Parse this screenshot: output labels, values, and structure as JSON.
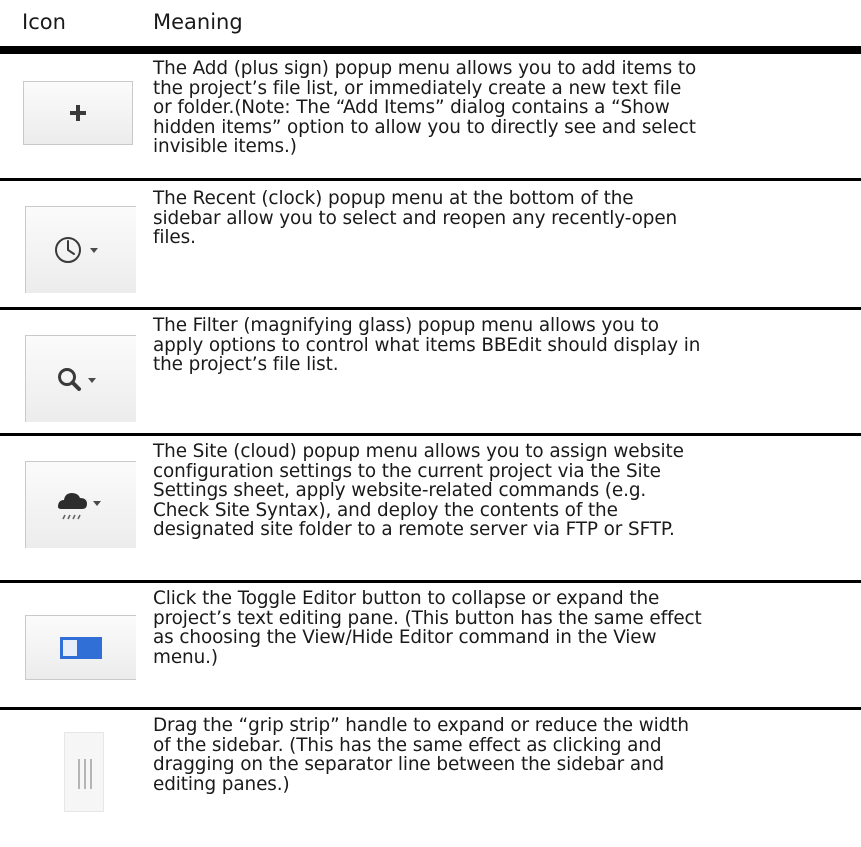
{
  "header": {
    "icon_col": "Icon",
    "meaning_col": "Meaning"
  },
  "rows": [
    {
      "icon": "plus-icon",
      "text": "The Add (plus sign) popup menu allows you to add items to\nthe project’s file list, or immediately create a new text file\nor folder.(Note: The “Add Items” dialog contains a “Show\nhidden items” option to allow you to directly see and select\ninvisible items.)"
    },
    {
      "icon": "clock-icon",
      "text": "The Recent (clock) popup menu at the bottom of the\nsidebar allow you to select and reopen any recently-open\nfiles."
    },
    {
      "icon": "magnifying-glass-icon",
      "text": "The Filter (magnifying glass) popup menu allows you to\napply options to control what items BBEdit should display in\nthe project’s file list."
    },
    {
      "icon": "cloud-icon",
      "text": "The Site (cloud) popup menu allows you to assign website\nconfiguration settings to the current project via the Site\nSettings sheet, apply website-related commands (e.g.\nCheck Site Syntax), and deploy the contents of the\ndesignated site folder to a remote server via FTP or SFTP."
    },
    {
      "icon": "toggle-editor-icon",
      "text": "Click the Toggle Editor button to collapse or expand the\nproject’s text editing pane. (This button has the same effect\nas choosing the View/Hide Editor command in the View\nmenu.)"
    },
    {
      "icon": "grip-strip-icon",
      "text": "Drag the “grip strip” handle to expand or reduce the width\nof the sidebar. (This has the same effect as clicking and\ndragging on the separator line between the sidebar and\nediting panes.)"
    }
  ]
}
